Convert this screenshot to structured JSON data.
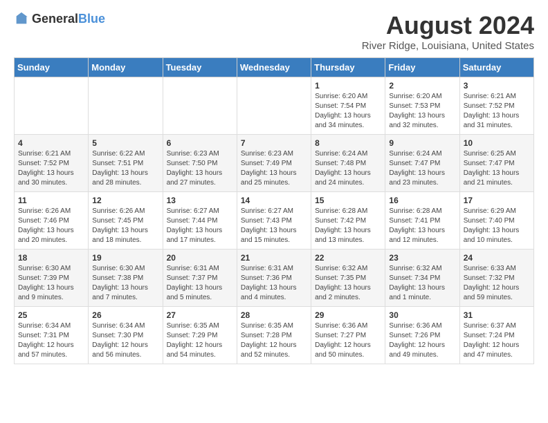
{
  "logo": {
    "text_general": "General",
    "text_blue": "Blue"
  },
  "header": {
    "title": "August 2024",
    "subtitle": "River Ridge, Louisiana, United States"
  },
  "days_of_week": [
    "Sunday",
    "Monday",
    "Tuesday",
    "Wednesday",
    "Thursday",
    "Friday",
    "Saturday"
  ],
  "weeks": [
    [
      {
        "day": "",
        "content": ""
      },
      {
        "day": "",
        "content": ""
      },
      {
        "day": "",
        "content": ""
      },
      {
        "day": "",
        "content": ""
      },
      {
        "day": "1",
        "content": "Sunrise: 6:20 AM\nSunset: 7:54 PM\nDaylight: 13 hours and 34 minutes."
      },
      {
        "day": "2",
        "content": "Sunrise: 6:20 AM\nSunset: 7:53 PM\nDaylight: 13 hours and 32 minutes."
      },
      {
        "day": "3",
        "content": "Sunrise: 6:21 AM\nSunset: 7:52 PM\nDaylight: 13 hours and 31 minutes."
      }
    ],
    [
      {
        "day": "4",
        "content": "Sunrise: 6:21 AM\nSunset: 7:52 PM\nDaylight: 13 hours and 30 minutes."
      },
      {
        "day": "5",
        "content": "Sunrise: 6:22 AM\nSunset: 7:51 PM\nDaylight: 13 hours and 28 minutes."
      },
      {
        "day": "6",
        "content": "Sunrise: 6:23 AM\nSunset: 7:50 PM\nDaylight: 13 hours and 27 minutes."
      },
      {
        "day": "7",
        "content": "Sunrise: 6:23 AM\nSunset: 7:49 PM\nDaylight: 13 hours and 25 minutes."
      },
      {
        "day": "8",
        "content": "Sunrise: 6:24 AM\nSunset: 7:48 PM\nDaylight: 13 hours and 24 minutes."
      },
      {
        "day": "9",
        "content": "Sunrise: 6:24 AM\nSunset: 7:47 PM\nDaylight: 13 hours and 23 minutes."
      },
      {
        "day": "10",
        "content": "Sunrise: 6:25 AM\nSunset: 7:47 PM\nDaylight: 13 hours and 21 minutes."
      }
    ],
    [
      {
        "day": "11",
        "content": "Sunrise: 6:26 AM\nSunset: 7:46 PM\nDaylight: 13 hours and 20 minutes."
      },
      {
        "day": "12",
        "content": "Sunrise: 6:26 AM\nSunset: 7:45 PM\nDaylight: 13 hours and 18 minutes."
      },
      {
        "day": "13",
        "content": "Sunrise: 6:27 AM\nSunset: 7:44 PM\nDaylight: 13 hours and 17 minutes."
      },
      {
        "day": "14",
        "content": "Sunrise: 6:27 AM\nSunset: 7:43 PM\nDaylight: 13 hours and 15 minutes."
      },
      {
        "day": "15",
        "content": "Sunrise: 6:28 AM\nSunset: 7:42 PM\nDaylight: 13 hours and 13 minutes."
      },
      {
        "day": "16",
        "content": "Sunrise: 6:28 AM\nSunset: 7:41 PM\nDaylight: 13 hours and 12 minutes."
      },
      {
        "day": "17",
        "content": "Sunrise: 6:29 AM\nSunset: 7:40 PM\nDaylight: 13 hours and 10 minutes."
      }
    ],
    [
      {
        "day": "18",
        "content": "Sunrise: 6:30 AM\nSunset: 7:39 PM\nDaylight: 13 hours and 9 minutes."
      },
      {
        "day": "19",
        "content": "Sunrise: 6:30 AM\nSunset: 7:38 PM\nDaylight: 13 hours and 7 minutes."
      },
      {
        "day": "20",
        "content": "Sunrise: 6:31 AM\nSunset: 7:37 PM\nDaylight: 13 hours and 5 minutes."
      },
      {
        "day": "21",
        "content": "Sunrise: 6:31 AM\nSunset: 7:36 PM\nDaylight: 13 hours and 4 minutes."
      },
      {
        "day": "22",
        "content": "Sunrise: 6:32 AM\nSunset: 7:35 PM\nDaylight: 13 hours and 2 minutes."
      },
      {
        "day": "23",
        "content": "Sunrise: 6:32 AM\nSunset: 7:34 PM\nDaylight: 13 hours and 1 minute."
      },
      {
        "day": "24",
        "content": "Sunrise: 6:33 AM\nSunset: 7:32 PM\nDaylight: 12 hours and 59 minutes."
      }
    ],
    [
      {
        "day": "25",
        "content": "Sunrise: 6:34 AM\nSunset: 7:31 PM\nDaylight: 12 hours and 57 minutes."
      },
      {
        "day": "26",
        "content": "Sunrise: 6:34 AM\nSunset: 7:30 PM\nDaylight: 12 hours and 56 minutes."
      },
      {
        "day": "27",
        "content": "Sunrise: 6:35 AM\nSunset: 7:29 PM\nDaylight: 12 hours and 54 minutes."
      },
      {
        "day": "28",
        "content": "Sunrise: 6:35 AM\nSunset: 7:28 PM\nDaylight: 12 hours and 52 minutes."
      },
      {
        "day": "29",
        "content": "Sunrise: 6:36 AM\nSunset: 7:27 PM\nDaylight: 12 hours and 50 minutes."
      },
      {
        "day": "30",
        "content": "Sunrise: 6:36 AM\nSunset: 7:26 PM\nDaylight: 12 hours and 49 minutes."
      },
      {
        "day": "31",
        "content": "Sunrise: 6:37 AM\nSunset: 7:24 PM\nDaylight: 12 hours and 47 minutes."
      }
    ]
  ]
}
